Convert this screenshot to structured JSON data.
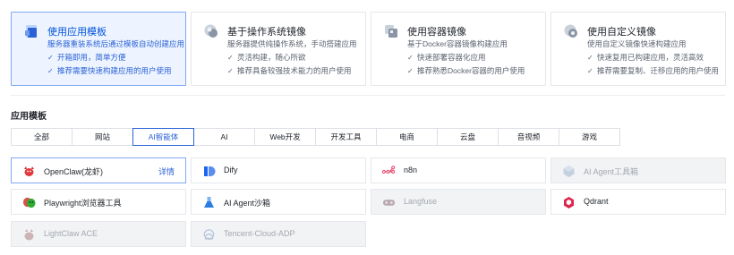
{
  "mode_cards": [
    {
      "title": "使用应用模板",
      "subtitle": "服务器重装系统后通过模板自动创建应用",
      "features": [
        "开箱即用，简单方便",
        "推荐需要快速构建应用的用户使用"
      ],
      "icon": "app-template-icon",
      "selected": true
    },
    {
      "title": "基于操作系统镜像",
      "subtitle": "服务器提供纯操作系统，手动搭建应用",
      "features": [
        "灵活构建，随心所欲",
        "推荐具备较强技术能力的用户使用"
      ],
      "icon": "os-image-icon",
      "selected": false
    },
    {
      "title": "使用容器镜像",
      "subtitle": "基于Docker容器镜像构建应用",
      "features": [
        "快速部署容器化应用",
        "推荐熟悉Docker容器的用户使用"
      ],
      "icon": "container-image-icon",
      "selected": false
    },
    {
      "title": "使用自定义镜像",
      "subtitle": "使用自定义镜像快速构建应用",
      "features": [
        "快速复用已构建应用，灵活高效",
        "推荐需要复制、迁移应用的用户使用"
      ],
      "icon": "custom-image-icon",
      "selected": false
    }
  ],
  "section": {
    "title": "应用模板"
  },
  "tabs": [
    "全部",
    "网站",
    "AI智能体",
    "AI",
    "Web开发",
    "开发工具",
    "电商",
    "云盘",
    "音视频",
    "游戏"
  ],
  "active_tab": "AI智能体",
  "apps": [
    {
      "name": "OpenClaw(龙虾)",
      "detail": "详情",
      "icon": "openclaw-icon",
      "state": "selected"
    },
    {
      "name": "Dify",
      "icon": "dify-icon",
      "state": "normal"
    },
    {
      "name": "n8n",
      "icon": "n8n-icon",
      "state": "normal"
    },
    {
      "name": "AI Agent工具箱",
      "icon": "ai-agent-toolbox-icon",
      "state": "disabled"
    },
    {
      "name": "Playwright浏览器工具",
      "icon": "playwright-icon",
      "state": "normal"
    },
    {
      "name": "AI Agent沙箱",
      "icon": "ai-agent-sandbox-icon",
      "state": "normal"
    },
    {
      "name": "Langfuse",
      "icon": "langfuse-icon",
      "state": "disabled"
    },
    {
      "name": "Qdrant",
      "icon": "qdrant-icon",
      "state": "normal"
    },
    {
      "name": "LightClaw ACE",
      "icon": "lightclaw-icon",
      "state": "disabled"
    },
    {
      "name": "Tencent-Cloud-ADP",
      "icon": "tencent-cloud-adp-icon",
      "state": "disabled"
    }
  ],
  "colors": {
    "accent": "#2a62d6",
    "selected_bg": "#eef4ff",
    "disabled_bg": "#f2f3f5"
  }
}
